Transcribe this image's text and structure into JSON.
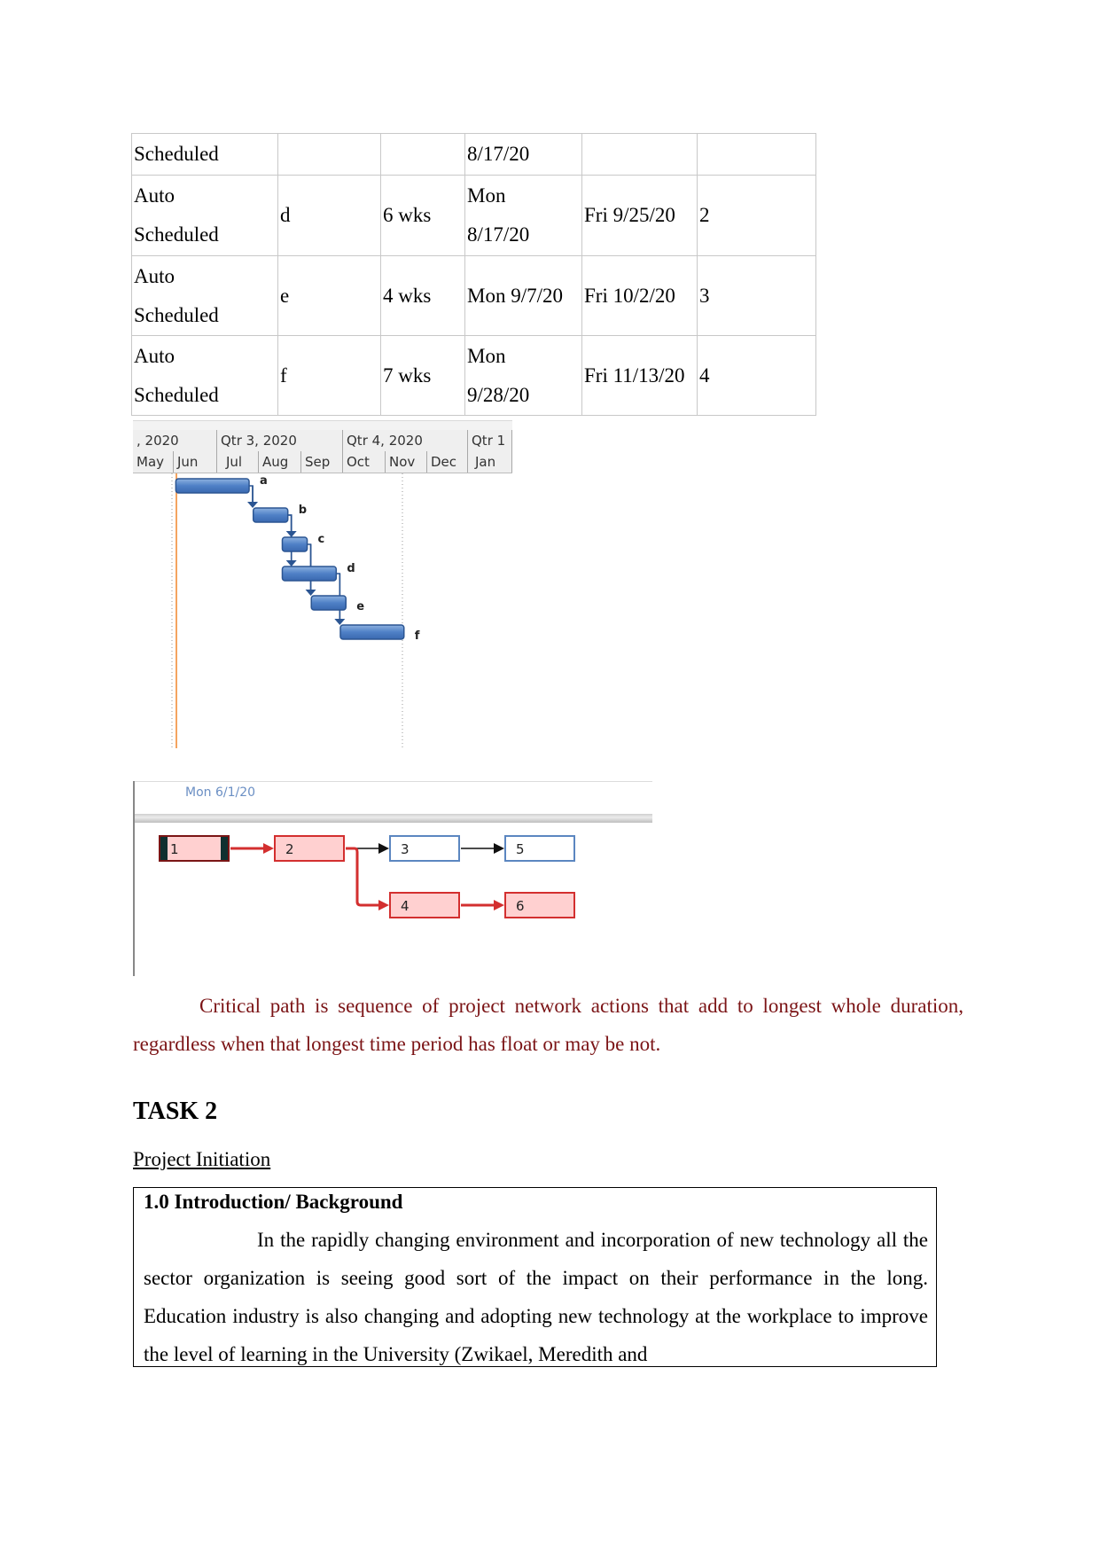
{
  "schedule_table": {
    "rows": [
      {
        "mode": [
          "Scheduled"
        ],
        "task": "",
        "duration": "",
        "start": [
          "8/17/20"
        ],
        "finish": "",
        "predecessor": ""
      },
      {
        "mode": [
          "Auto",
          "Scheduled"
        ],
        "task": "d",
        "duration": "6 wks",
        "start": [
          "Mon",
          "8/17/20"
        ],
        "finish": "Fri 9/25/20",
        "predecessor": "2"
      },
      {
        "mode": [
          "Auto",
          "Scheduled"
        ],
        "task": "e",
        "duration": "4 wks",
        "start": [
          "Mon 9/7/20"
        ],
        "finish": "Fri 10/2/20",
        "predecessor": "3"
      },
      {
        "mode": [
          "Auto",
          "Scheduled"
        ],
        "task": "f",
        "duration": "7 wks",
        "start": [
          "Mon",
          "9/28/20"
        ],
        "finish": "Fri 11/13/20",
        "predecessor": "4"
      }
    ]
  },
  "gantt": {
    "quarters": [
      ", 2020",
      "Qtr 3, 2020",
      "Qtr 4, 2020",
      "Qtr 1"
    ],
    "months": [
      "May",
      "Jun",
      "Jul",
      "Aug",
      "Sep",
      "Oct",
      "Nov",
      "Dec",
      "Jan"
    ],
    "tasks": [
      {
        "label": "a",
        "start": "2020-06-01",
        "finish": "2020-07-24"
      },
      {
        "label": "b",
        "start": "2020-07-27",
        "finish": "2020-08-21"
      },
      {
        "label": "c",
        "start": "2020-08-17",
        "finish": "2020-09-04"
      },
      {
        "label": "d",
        "start": "2020-08-17",
        "finish": "2020-09-25"
      },
      {
        "label": "e",
        "start": "2020-09-07",
        "finish": "2020-10-02"
      },
      {
        "label": "f",
        "start": "2020-09-28",
        "finish": "2020-11-13"
      }
    ],
    "colors": {
      "bar": "#4a7bc2",
      "today_line": "#f4a460"
    }
  },
  "network": {
    "date_label": "Mon 6/1/20",
    "nodes": [
      {
        "id": "1",
        "critical": true,
        "selected": true
      },
      {
        "id": "2",
        "critical": true
      },
      {
        "id": "3",
        "critical": false
      },
      {
        "id": "5",
        "critical": false
      },
      {
        "id": "4",
        "critical": true
      },
      {
        "id": "6",
        "critical": true
      }
    ],
    "links": [
      [
        "1",
        "2",
        true
      ],
      [
        "2",
        "3",
        false
      ],
      [
        "3",
        "5",
        false
      ],
      [
        "2",
        "4",
        true
      ],
      [
        "4",
        "6",
        true
      ]
    ],
    "colors": {
      "critical": "#d32f2f",
      "normal": "#5b86c0"
    }
  },
  "critical_path_text": "Critical path is sequence of project network actions that add to longest whole duration, regardless when that longest time period has float or may be not.",
  "task2_heading": "TASK 2",
  "project_initiation": "Project Initiation",
  "intro": {
    "heading": "1.0 Introduction/ Background",
    "body": "In the rapidly changing environment and incorporation of new technology all the sector organization is seeing good sort of the impact on their performance in the long. Education industry is also changing and adopting new technology at the workplace to improve the level of learning in the University (Zwikael, Meredith and"
  }
}
